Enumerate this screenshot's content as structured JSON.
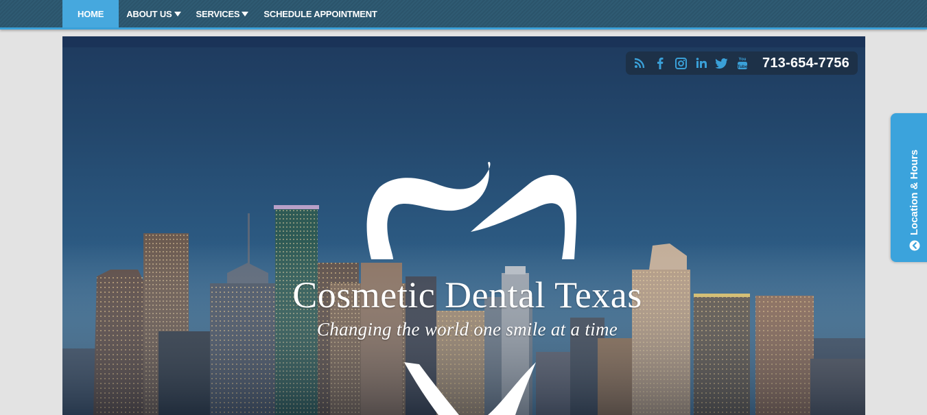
{
  "nav": {
    "items": [
      {
        "label": "HOME",
        "active": true,
        "dropdown": false
      },
      {
        "label": "ABOUT US",
        "active": false,
        "dropdown": true
      },
      {
        "label": "SERVICES",
        "active": false,
        "dropdown": true
      },
      {
        "label": "SCHEDULE APPOINTMENT",
        "active": false,
        "dropdown": false
      }
    ]
  },
  "social": {
    "icons": [
      "rss-icon",
      "facebook-icon",
      "instagram-icon",
      "linkedin-icon",
      "twitter-icon",
      "youtube-icon"
    ],
    "phone": "713-654-7756"
  },
  "hero": {
    "title": "Cosmetic Dental Texas",
    "tagline": "Changing the world one smile at a time"
  },
  "side_tab": {
    "label": "Location & Hours",
    "icon": "circle-chevron-left-icon"
  },
  "colors": {
    "nav_bg": "#2f5b73",
    "nav_accent": "#3aa0d8",
    "active_item": "#46a8de",
    "social_bar": "#1d3148",
    "social_icon": "#3aa0d8",
    "side_tab": "#3ba3dc",
    "page_bg": "#e3e3e3"
  }
}
